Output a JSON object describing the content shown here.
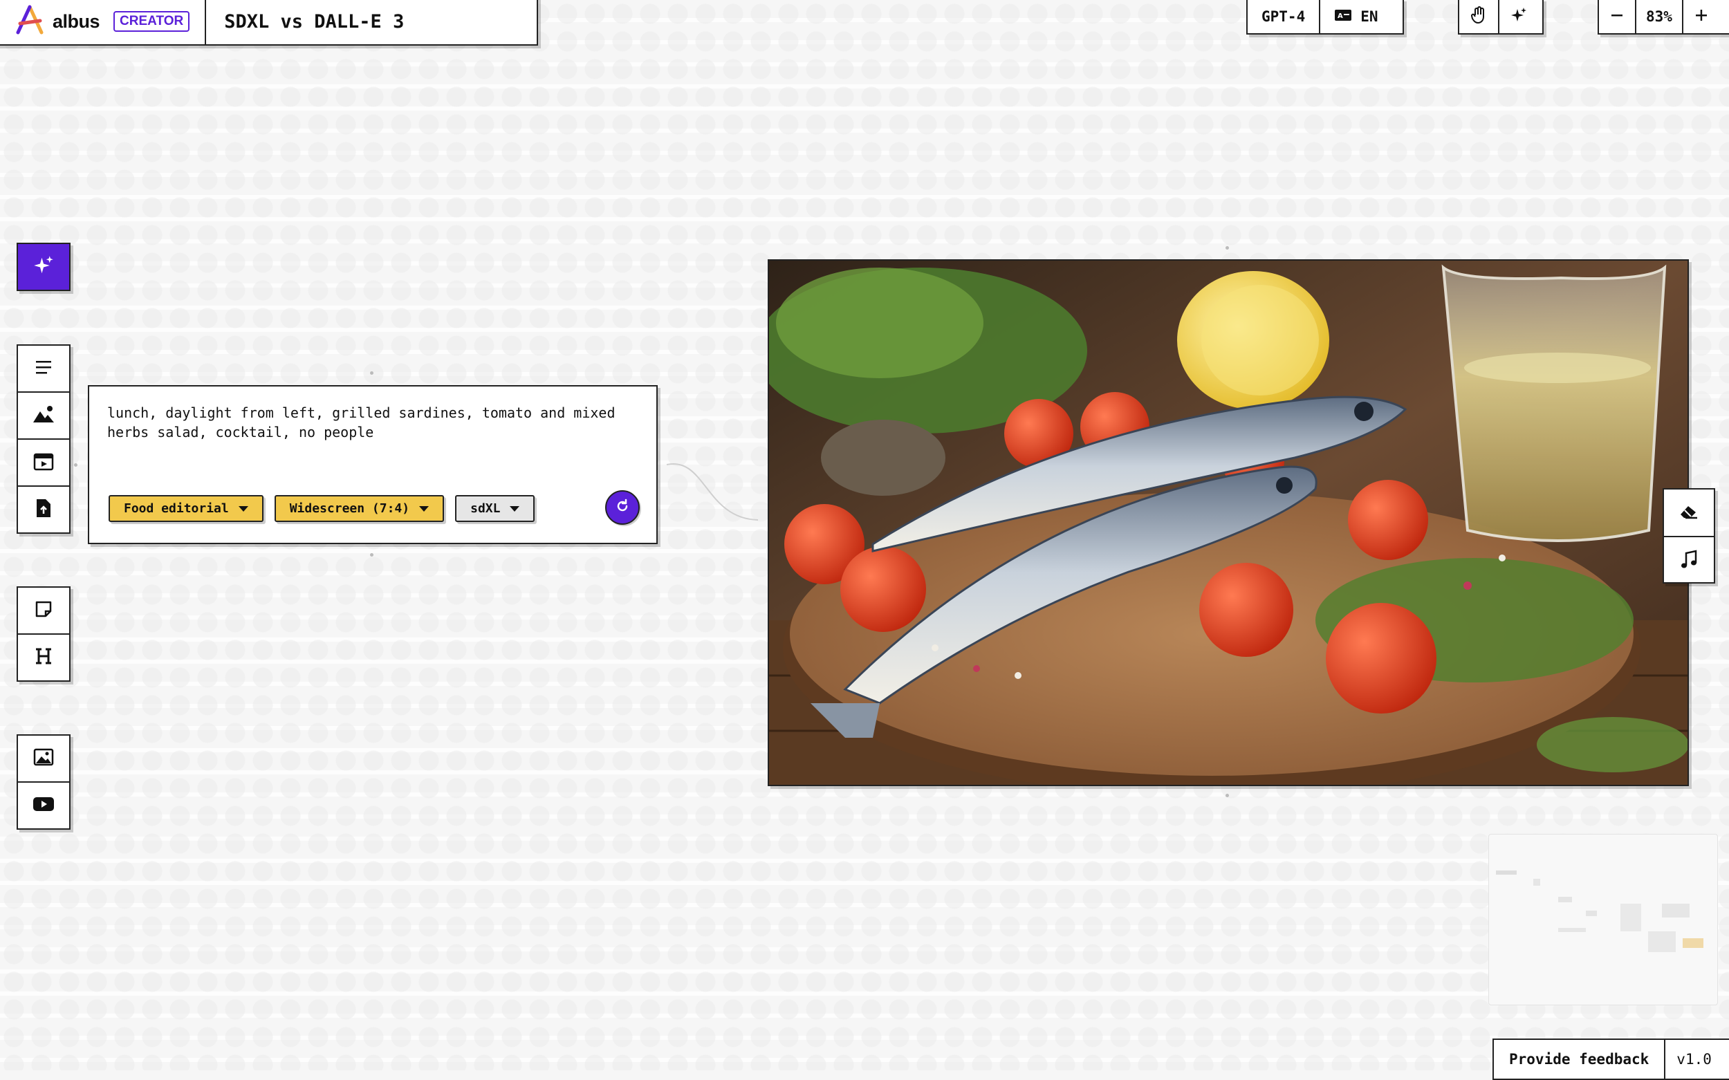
{
  "app": {
    "brand": "albus",
    "badge": "CREATOR",
    "board_title": "SDXL vs DALL-E 3"
  },
  "topbar": {
    "model": "GPT-4",
    "language": "EN",
    "zoom": "83%"
  },
  "prompt_node": {
    "text": "lunch, daylight from left, grilled sardines, tomato and mixed herbs salad, cocktail, no people",
    "chips": [
      {
        "label": "Food editorial"
      },
      {
        "label": "Widescreen (7:4)"
      },
      {
        "label": "sdXL"
      }
    ]
  },
  "footer": {
    "feedback": "Provide feedback",
    "version": "v1.0"
  },
  "colors": {
    "accent": "#5b21d9",
    "chip_yellow": "#f2c94c",
    "chip_grey": "#e6e6e6"
  },
  "icons": {
    "toolbar_primary": "sparkle-icon",
    "left_tools": [
      "text-lines-icon",
      "image-mountain-icon",
      "video-clapper-icon",
      "upload-file-icon",
      "sticky-note-icon",
      "heading-icon",
      "picture-icon",
      "youtube-icon"
    ],
    "right_tools": [
      "eraser-icon",
      "music-note-icon"
    ],
    "top_tools": [
      "hand-icon",
      "sparkle-icon"
    ]
  }
}
